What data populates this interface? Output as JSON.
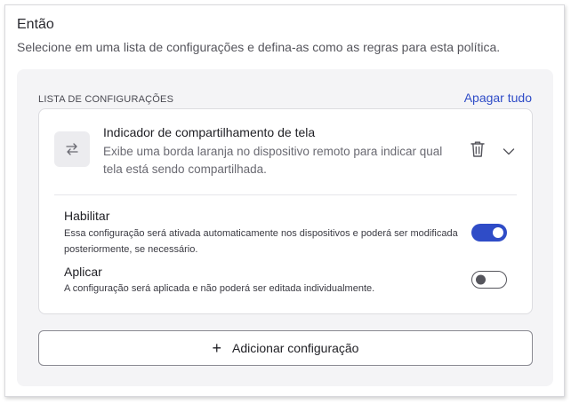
{
  "header": {
    "title": "Então",
    "subtitle": "Selecione em uma lista de configurações e defina-as como as regras para esta política."
  },
  "list": {
    "label": "LISTA DE CONFIGURAÇÕES",
    "clear_all": "Apagar tudo"
  },
  "setting": {
    "icon": "swap-arrows-icon",
    "title": "Indicador de compartilhamento de tela",
    "description": "Exibe uma borda laranja no dispositivo remoto para indicar qual tela está sendo compartilhada.",
    "options": [
      {
        "title": "Habilitar",
        "description": "Essa configuração será ativada automaticamente nos dispositivos e poderá ser modificada posteriormente, se necessário.",
        "enabled": true
      },
      {
        "title": "Aplicar",
        "description": "A configuração será aplicada e não poderá ser editada individualmente.",
        "enabled": false
      }
    ]
  },
  "add_button": {
    "icon": "plus-icon",
    "label": "Adicionar configuração"
  },
  "colors": {
    "accent": "#2f4cc7",
    "panel_bg": "#f4f4f6"
  }
}
